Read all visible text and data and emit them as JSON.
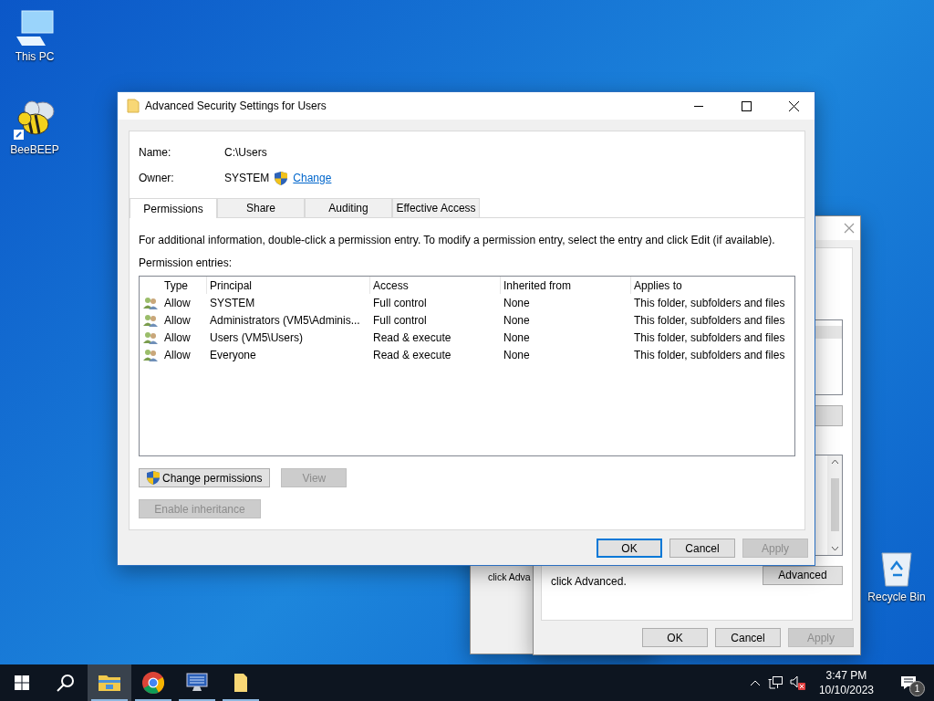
{
  "desktop_icons": [
    {
      "kind": "computer",
      "label": "This PC"
    },
    {
      "kind": "bee",
      "label": "BeeBEEP"
    },
    {
      "kind": "recycle-bin",
      "label": "Recycle Bin"
    }
  ],
  "back_windows": [
    {
      "text": "click Adva"
    },
    {
      "text": "click Advanced.",
      "advanced_button": "Advanced",
      "buttons": [
        {
          "label": "OK",
          "disabled": false
        },
        {
          "label": "Cancel",
          "disabled": false
        },
        {
          "label": "Apply",
          "disabled": true
        }
      ]
    }
  ],
  "dialog": {
    "title": "Advanced Security Settings for Users",
    "fields": [
      {
        "label": "Name:",
        "value": "C:\\Users"
      },
      {
        "label": "Owner:",
        "value": "SYSTEM",
        "link": "Change"
      }
    ],
    "tabs": [
      {
        "label": "Permissions",
        "selected": true
      },
      {
        "label": "Share",
        "selected": false
      },
      {
        "label": "Auditing",
        "selected": false
      },
      {
        "label": "Effective Access",
        "selected": false
      }
    ],
    "info_text": "For additional information, double-click a permission entry. To modify a permission entry, select the entry and click Edit (if available).",
    "entries_label": "Permission entries:",
    "columns": [
      "Type",
      "Principal",
      "Access",
      "Inherited from",
      "Applies to"
    ],
    "rows": [
      {
        "type": "Allow",
        "principal": "SYSTEM",
        "access": "Full control",
        "inherited_from": "None",
        "applies_to": "This folder, subfolders and files"
      },
      {
        "type": "Allow",
        "principal": "Administrators (VM5\\Adminis...",
        "access": "Full control",
        "inherited_from": "None",
        "applies_to": "This folder, subfolders and files"
      },
      {
        "type": "Allow",
        "principal": "Users (VM5\\Users)",
        "access": "Read & execute",
        "inherited_from": "None",
        "applies_to": "This folder, subfolders and files"
      },
      {
        "type": "Allow",
        "principal": "Everyone",
        "access": "Read & execute",
        "inherited_from": "None",
        "applies_to": "This folder, subfolders and files"
      }
    ],
    "action_buttons": [
      {
        "label": "Change permissions",
        "shield": true,
        "disabled": false
      },
      {
        "label": "View",
        "shield": false,
        "disabled": true
      }
    ],
    "inheritance_button": {
      "label": "Enable inheritance",
      "disabled": true
    },
    "footer_buttons": [
      {
        "label": "OK",
        "disabled": false,
        "default": true
      },
      {
        "label": "Cancel",
        "disabled": false,
        "default": false
      },
      {
        "label": "Apply",
        "disabled": true,
        "default": false
      }
    ]
  },
  "taskbar": {
    "apps": [
      {
        "kind": "explorer",
        "active": true
      },
      {
        "kind": "chrome",
        "active": false
      },
      {
        "kind": "monitor",
        "active": false
      },
      {
        "kind": "folder",
        "active": false
      }
    ],
    "time": "3:47 PM",
    "date": "10/10/2023",
    "notification_count": "1"
  }
}
